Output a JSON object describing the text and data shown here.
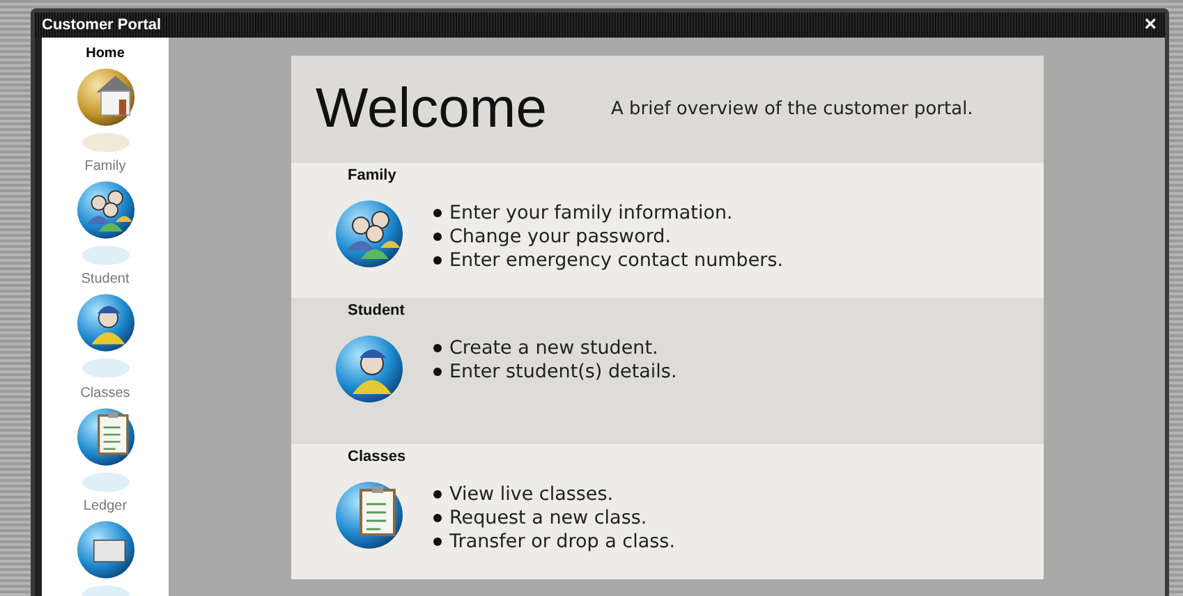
{
  "window": {
    "title": "Customer Portal",
    "close": "×"
  },
  "sidebar": {
    "items": [
      {
        "label": "Home",
        "kind": "home",
        "selected": true
      },
      {
        "label": "Family",
        "kind": "family",
        "selected": false
      },
      {
        "label": "Student",
        "kind": "student",
        "selected": false
      },
      {
        "label": "Classes",
        "kind": "classes",
        "selected": false
      },
      {
        "label": "Ledger",
        "kind": "ledger",
        "selected": false
      }
    ]
  },
  "header": {
    "title": "Welcome",
    "subtitle": "A brief overview of the customer portal."
  },
  "sections": [
    {
      "title": "Family",
      "kind": "family",
      "items": [
        "Enter your family information.",
        "Change your password.",
        "Enter emergency contact numbers."
      ]
    },
    {
      "title": "Student",
      "kind": "student",
      "items": [
        "Create a new student.",
        "Enter student(s) details."
      ]
    },
    {
      "title": "Classes",
      "kind": "classes",
      "items": [
        "View live classes.",
        "Request a new class.",
        "Transfer or drop a class."
      ]
    }
  ]
}
